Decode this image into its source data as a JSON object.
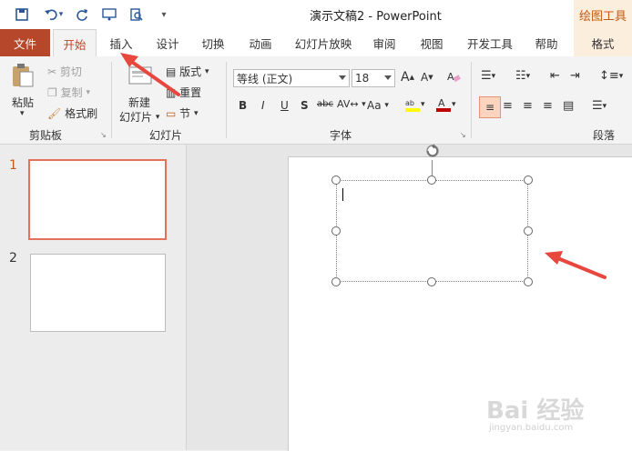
{
  "window": {
    "title": "演示文稿2  -  PowerPoint",
    "contextual_tab_group": "绘图工具"
  },
  "tabs": {
    "file": "文件",
    "home": "开始",
    "insert": "插入",
    "design": "设计",
    "transitions": "切换",
    "animations": "动画",
    "slideshow": "幻灯片放映",
    "review": "审阅",
    "view": "视图",
    "developer": "开发工具",
    "help": "帮助",
    "format": "格式"
  },
  "clipboard": {
    "label": "剪贴板",
    "paste": "粘贴",
    "cut": "剪切",
    "copy": "复制",
    "format_painter": "格式刷"
  },
  "slides_group": {
    "label": "幻灯片",
    "new_slide_line1": "新建",
    "new_slide_line2": "幻灯片",
    "layout": "版式",
    "reset": "重置",
    "section": "节"
  },
  "font_group": {
    "label": "字体",
    "font_name": "等线 (正文)",
    "font_size": "18",
    "bold": "B",
    "italic": "I",
    "underline": "U",
    "shadow": "S",
    "strikethrough": "abc",
    "case": "Aa"
  },
  "paragraph_group": {
    "label": "段落"
  },
  "thumbnails": {
    "slide1_number": "1",
    "slide2_number": "2"
  },
  "watermark": {
    "brand": "Bai 经验",
    "url": "jingyan.baidu.com"
  },
  "colors": {
    "accent": "#b7472a",
    "context_tab": "#fbeedc",
    "context_text": "#c45911",
    "arrow": "#e8473e"
  }
}
